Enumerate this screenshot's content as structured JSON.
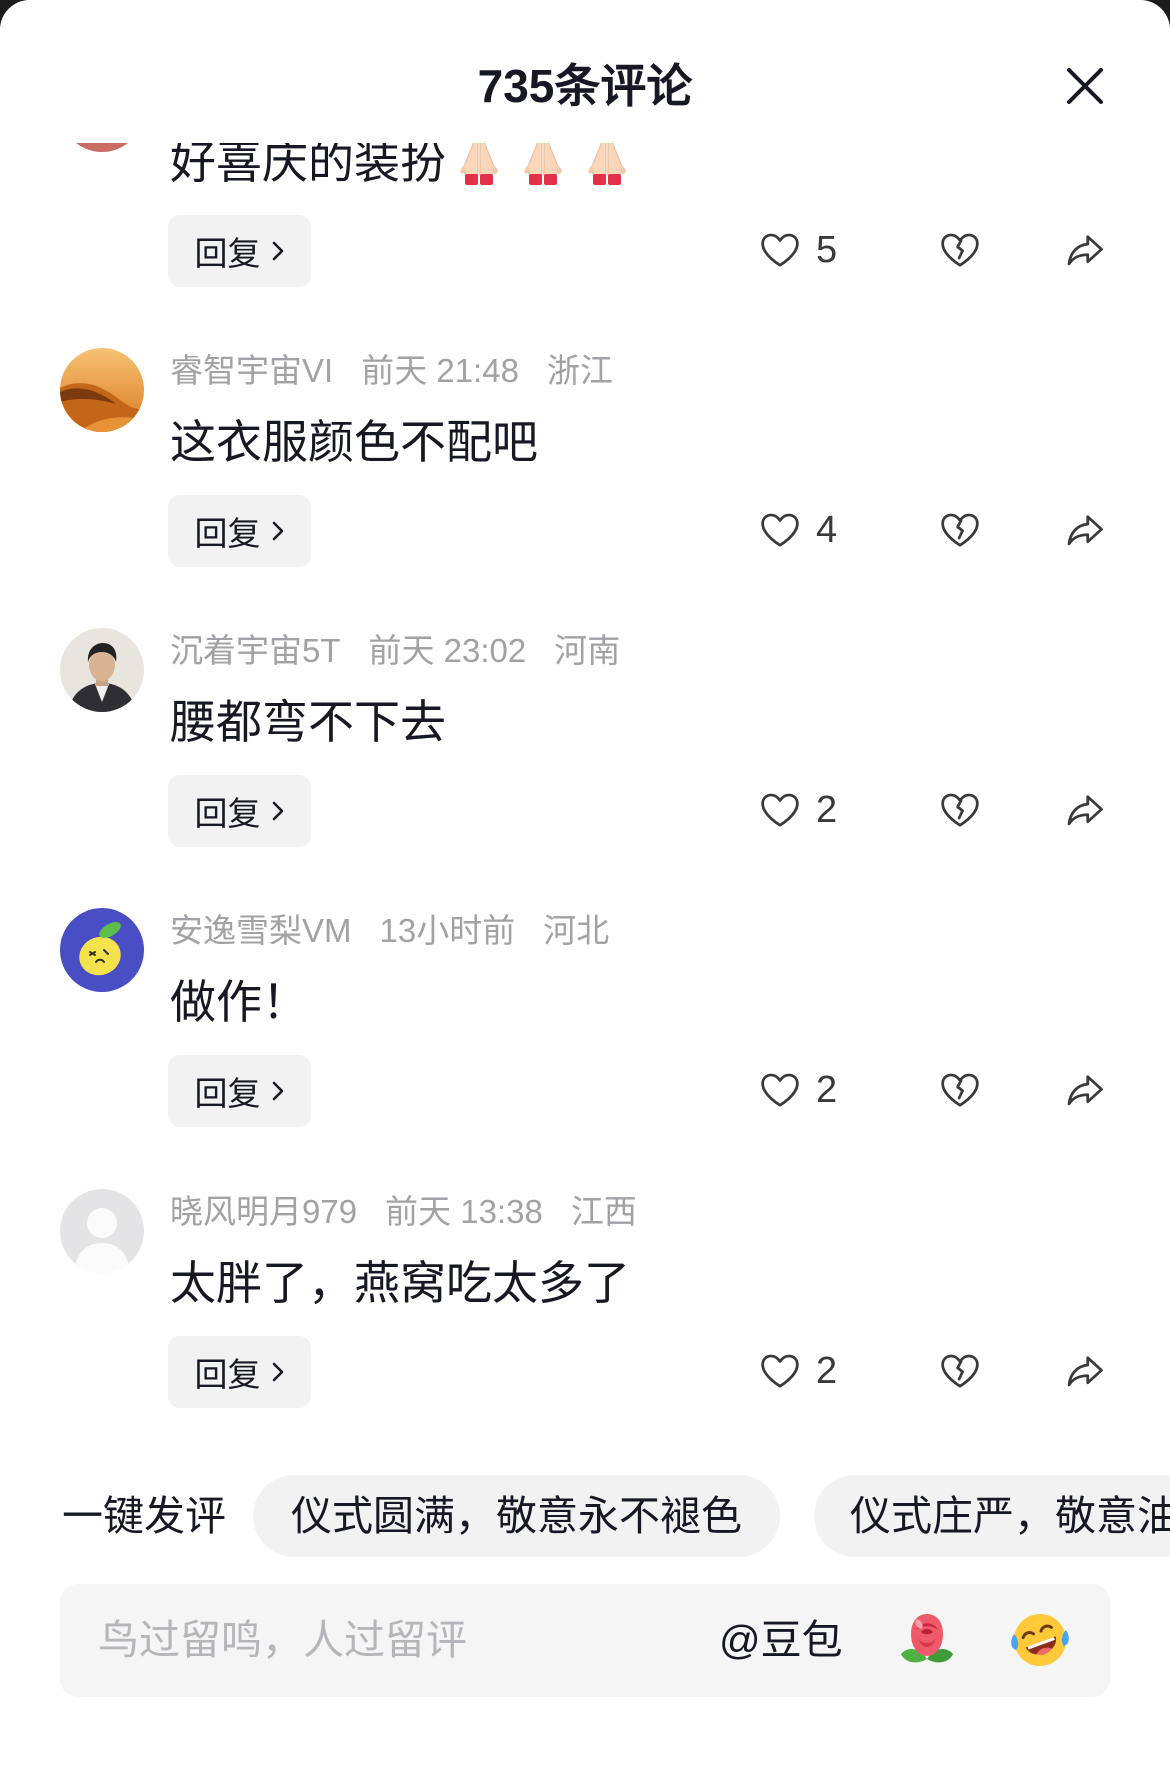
{
  "header": {
    "title": "735条评论"
  },
  "comments": [
    {
      "text": "好喜庆的装扮",
      "emoji": [
        "pray-emoji-icon",
        "pray-emoji-icon",
        "pray-emoji-icon"
      ],
      "reply_label": "回复",
      "likes": "5"
    },
    {
      "username": "睿智宇宙VI",
      "time": "前天 21:48",
      "location": "浙江",
      "text": "这衣服颜色不配吧",
      "reply_label": "回复",
      "likes": "4"
    },
    {
      "username": "沉着宇宙5T",
      "time": "前天 23:02",
      "location": "河南",
      "text": "腰都弯不下去",
      "reply_label": "回复",
      "likes": "2"
    },
    {
      "username": "安逸雪梨VM",
      "time": "13小时前",
      "location": "河北",
      "text": "做作！",
      "reply_label": "回复",
      "likes": "2"
    },
    {
      "username": "晓风明月979",
      "time": "前天 13:38",
      "location": "江西",
      "text": "太胖了，燕窝吃太多了",
      "reply_label": "回复",
      "likes": "2"
    }
  ],
  "quick_comment": {
    "label": "一键发评",
    "chips": [
      "仪式圆满，敬意永不褪色",
      "仪式庄严，敬意油"
    ]
  },
  "composer": {
    "placeholder": "鸟过留鸣，人过留评",
    "mention": "@豆包",
    "emoji_buttons": [
      "rose-emoji-icon",
      "laughing-emoji-icon"
    ]
  },
  "icons": {
    "close": "close-icon",
    "like": "heart-outline-icon",
    "dislike": "broken-heart-icon",
    "share": "share-arrow-icon",
    "reply_chevron": "chevron-right-icon"
  },
  "colors": {
    "text": "#161823",
    "meta": "#a1a1a6",
    "pill_background": "#f2f2f2",
    "input_background": "#f5f5f6"
  }
}
